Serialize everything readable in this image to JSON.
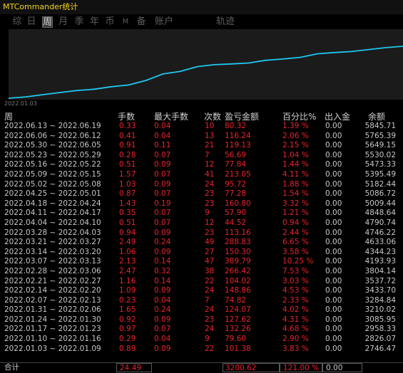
{
  "window": {
    "title": "MTCommander统计"
  },
  "tabs": [
    {
      "label": "综",
      "active": false
    },
    {
      "label": "日",
      "active": false
    },
    {
      "label": "周",
      "active": true
    },
    {
      "label": "月",
      "active": false
    },
    {
      "label": "季",
      "active": false
    },
    {
      "label": "年",
      "active": false
    },
    {
      "label": "币",
      "active": false
    },
    {
      "label": "M",
      "active": false
    },
    {
      "label": "备",
      "active": false
    },
    {
      "label": "账户",
      "active": false
    },
    {
      "label": "轨迹",
      "active": false
    }
  ],
  "colors": {
    "title": "#f2d21e",
    "line": "#1ec8f0",
    "value_red": "#e8242a",
    "text": "#c8c8c8"
  },
  "chart_data": {
    "type": "line",
    "start_label": "2022.01.03",
    "x": [
      "2022.01.03",
      "2022.01.10",
      "2022.01.17",
      "2022.01.24",
      "2022.01.31",
      "2022.02.07",
      "2022.02.14",
      "2022.02.21",
      "2022.02.28",
      "2022.03.07",
      "2022.03.14",
      "2022.03.21",
      "2022.03.28",
      "2022.04.04",
      "2022.04.11",
      "2022.04.18",
      "2022.04.25",
      "2022.05.02",
      "2022.05.09",
      "2022.05.16",
      "2022.05.23",
      "2022.05.30",
      "2022.06.06",
      "2022.06.13"
    ],
    "series": [
      {
        "values": [
          2746.47,
          2826.07,
          2958.33,
          3085.95,
          3210.02,
          3284.84,
          3433.7,
          3537.72,
          3804.14,
          4193.93,
          4344.23,
          4633.06,
          4746.22,
          4790.74,
          4848.64,
          5009.44,
          5086.72,
          5182.44,
          5395.49,
          5473.33,
          5530.02,
          5649.15,
          5765.39,
          5845.71
        ]
      }
    ]
  },
  "table": {
    "headers": {
      "week": "周",
      "lots": "手数",
      "max_lots": "最大手数",
      "count": "次数",
      "pl": "盈亏金额",
      "pct": "百分比%",
      "deposit": "出入金",
      "balance": "余额"
    },
    "rows": [
      {
        "week": "2022.06.13 ~ 2022.06.19",
        "lots": "0.33",
        "max": "0.04",
        "count": "10",
        "pl": "80.32",
        "pct": "1.39 %",
        "dep": "0.00",
        "bal": "5845.71"
      },
      {
        "week": "2022.06.06 ~ 2022.06.12",
        "lots": "0.41",
        "max": "0.04",
        "count": "13",
        "pl": "116.24",
        "pct": "2.06 %",
        "dep": "0.00",
        "bal": "5765.39"
      },
      {
        "week": "2022.05.30 ~ 2022.06.05",
        "lots": "0.91",
        "max": "0.11",
        "count": "21",
        "pl": "119.13",
        "pct": "2.15 %",
        "dep": "0.00",
        "bal": "5649.15"
      },
      {
        "week": "2022.05.23 ~ 2022.05.29",
        "lots": "0.28",
        "max": "0.07",
        "count": "7",
        "pl": "56.69",
        "pct": "1.04 %",
        "dep": "0.00",
        "bal": "5530.02"
      },
      {
        "week": "2022.05.16 ~ 2022.05.22",
        "lots": "0.51",
        "max": "0.09",
        "count": "12",
        "pl": "77.84",
        "pct": "1.44 %",
        "dep": "0.00",
        "bal": "5473.33"
      },
      {
        "week": "2022.05.09 ~ 2022.05.15",
        "lots": "1.57",
        "max": "0.07",
        "count": "41",
        "pl": "213.05",
        "pct": "4.11 %",
        "dep": "0.00",
        "bal": "5395.49"
      },
      {
        "week": "2022.05.02 ~ 2022.05.08",
        "lots": "1.03",
        "max": "0.09",
        "count": "24",
        "pl": "95.72",
        "pct": "1.88 %",
        "dep": "0.00",
        "bal": "5182.44"
      },
      {
        "week": "2022.04.25 ~ 2022.05.01",
        "lots": "0.87",
        "max": "0.07",
        "count": "23",
        "pl": "77.28",
        "pct": "1.54 %",
        "dep": "0.00",
        "bal": "5086.72"
      },
      {
        "week": "2022.04.18 ~ 2022.04.24",
        "lots": "1.43",
        "max": "0.19",
        "count": "23",
        "pl": "160.80",
        "pct": "3.32 %",
        "dep": "0.00",
        "bal": "5009.44"
      },
      {
        "week": "2022.04.11 ~ 2022.04.17",
        "lots": "0.35",
        "max": "0.07",
        "count": "9",
        "pl": "57.90",
        "pct": "1.21 %",
        "dep": "0.00",
        "bal": "4848.64"
      },
      {
        "week": "2022.04.04 ~ 2022.04.10",
        "lots": "0.51",
        "max": "0.07",
        "count": "12",
        "pl": "44.52",
        "pct": "0.94 %",
        "dep": "0.00",
        "bal": "4790.74"
      },
      {
        "week": "2022.03.28 ~ 2022.04.03",
        "lots": "0.94",
        "max": "0.09",
        "count": "23",
        "pl": "113.16",
        "pct": "2.44 %",
        "dep": "0.00",
        "bal": "4746.22"
      },
      {
        "week": "2022.03.21 ~ 2022.03.27",
        "lots": "2.49",
        "max": "0.24",
        "count": "49",
        "pl": "288.83",
        "pct": "6.65 %",
        "dep": "0.00",
        "bal": "4633.06"
      },
      {
        "week": "2022.03.14 ~ 2022.03.20",
        "lots": "1.06",
        "max": "0.09",
        "count": "27",
        "pl": "150.30",
        "pct": "3.58 %",
        "dep": "0.00",
        "bal": "4344.23"
      },
      {
        "week": "2022.03.07 ~ 2022.03.13",
        "lots": "2.13",
        "max": "0.14",
        "count": "47",
        "pl": "389.79",
        "pct": "10.25 %",
        "dep": "0.00",
        "bal": "4193.93"
      },
      {
        "week": "2022.02.28 ~ 2022.03.06",
        "lots": "2.47",
        "max": "0.32",
        "count": "38",
        "pl": "266.42",
        "pct": "7.53 %",
        "dep": "0.00",
        "bal": "3804.14"
      },
      {
        "week": "2022.02.21 ~ 2022.02.27",
        "lots": "1.16",
        "max": "0.14",
        "count": "22",
        "pl": "104.02",
        "pct": "3.03 %",
        "dep": "0.00",
        "bal": "3537.72"
      },
      {
        "week": "2022.02.14 ~ 2022.02.20",
        "lots": "1.09",
        "max": "0.09",
        "count": "24",
        "pl": "148.86",
        "pct": "4.53 %",
        "dep": "0.00",
        "bal": "3433.70"
      },
      {
        "week": "2022.02.07 ~ 2022.02.13",
        "lots": "0.23",
        "max": "0.04",
        "count": "7",
        "pl": "74.82",
        "pct": "2.33 %",
        "dep": "0.00",
        "bal": "3284.84"
      },
      {
        "week": "2022.01.31 ~ 2022.02.06",
        "lots": "1.65",
        "max": "0.24",
        "count": "24",
        "pl": "124.07",
        "pct": "4.02 %",
        "dep": "0.00",
        "bal": "3210.02"
      },
      {
        "week": "2022.01.24 ~ 2022.01.30",
        "lots": "0.92",
        "max": "0.09",
        "count": "23",
        "pl": "127.62",
        "pct": "4.31 %",
        "dep": "0.00",
        "bal": "3085.95"
      },
      {
        "week": "2022.01.17 ~ 2022.01.23",
        "lots": "0.97",
        "max": "0.07",
        "count": "24",
        "pl": "132.26",
        "pct": "4.68 %",
        "dep": "0.00",
        "bal": "2958.33"
      },
      {
        "week": "2022.01.10 ~ 2022.01.16",
        "lots": "0.29",
        "max": "0.04",
        "count": "9",
        "pl": "79.60",
        "pct": "2.90 %",
        "dep": "0.00",
        "bal": "2826.07"
      },
      {
        "week": "2022.01.03 ~ 2022.01.09",
        "lots": "0.89",
        "max": "0.09",
        "count": "22",
        "pl": "101.38",
        "pct": "3.83 %",
        "dep": "0.00",
        "bal": "2746.47"
      }
    ],
    "total": {
      "label": "合计",
      "lots": "24.49",
      "pl": "3200.62",
      "pct": "121.00 %",
      "dep": "0.00"
    }
  }
}
